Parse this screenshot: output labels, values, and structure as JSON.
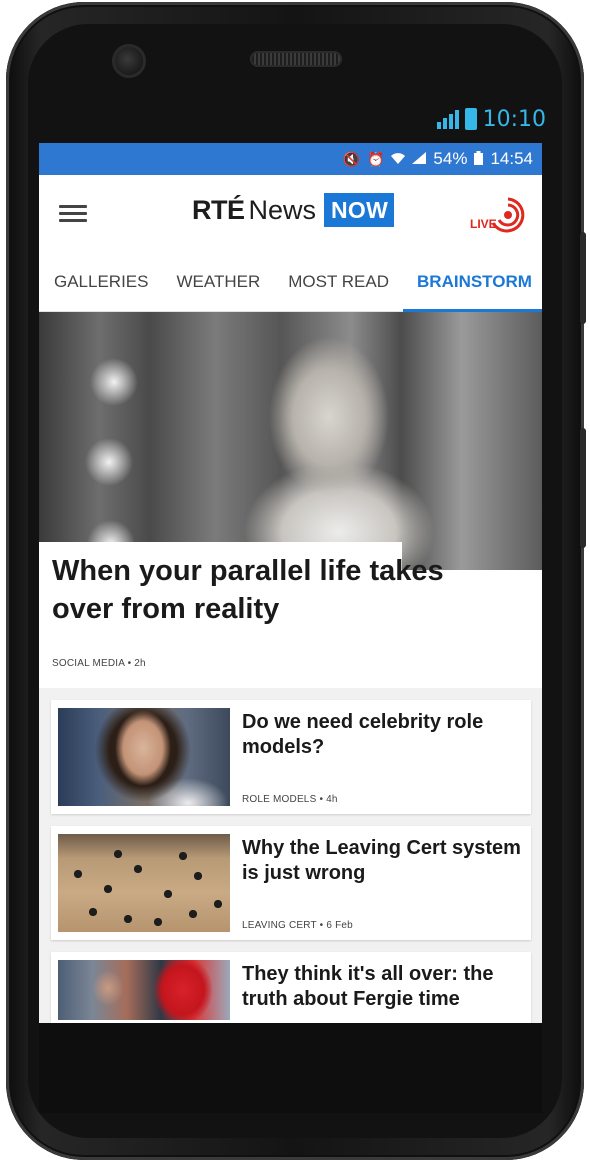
{
  "device": {
    "outer_status": {
      "time": "10:10"
    },
    "colors": {
      "accent": "#35b7e9"
    }
  },
  "status_bar": {
    "battery": "54%",
    "time": "14:54",
    "icons": [
      "mute-icon",
      "alarm-icon",
      "wifi-icon",
      "signal-icon",
      "battery-icon"
    ],
    "color": "#2f78d1"
  },
  "appbar": {
    "logo": {
      "rte": "RTÉ",
      "news": "News",
      "now": "NOW"
    },
    "live_label": "LIVE",
    "menu_icon": "hamburger-menu-icon",
    "live_icon": "live-broadcast-icon",
    "brand_color": "#1b78d6",
    "live_color": "#e0281f"
  },
  "tabs": [
    {
      "label": "GALLERIES",
      "active": false
    },
    {
      "label": "WEATHER",
      "active": false
    },
    {
      "label": "MOST READ",
      "active": false
    },
    {
      "label": "BRAINSTORM",
      "active": true
    }
  ],
  "hero": {
    "title": "When your parallel life takes over from reality",
    "category": "SOCIAL MEDIA",
    "age": "2h"
  },
  "articles": [
    {
      "title": "Do we need celebrity role models?",
      "category": "ROLE MODELS",
      "age": "4h"
    },
    {
      "title": "Why the Leaving Cert system is just wrong",
      "category": "LEAVING CERT",
      "age": "6 Feb"
    },
    {
      "title": "They think it's all over: the truth about Fergie time",
      "category": "",
      "age": ""
    }
  ]
}
